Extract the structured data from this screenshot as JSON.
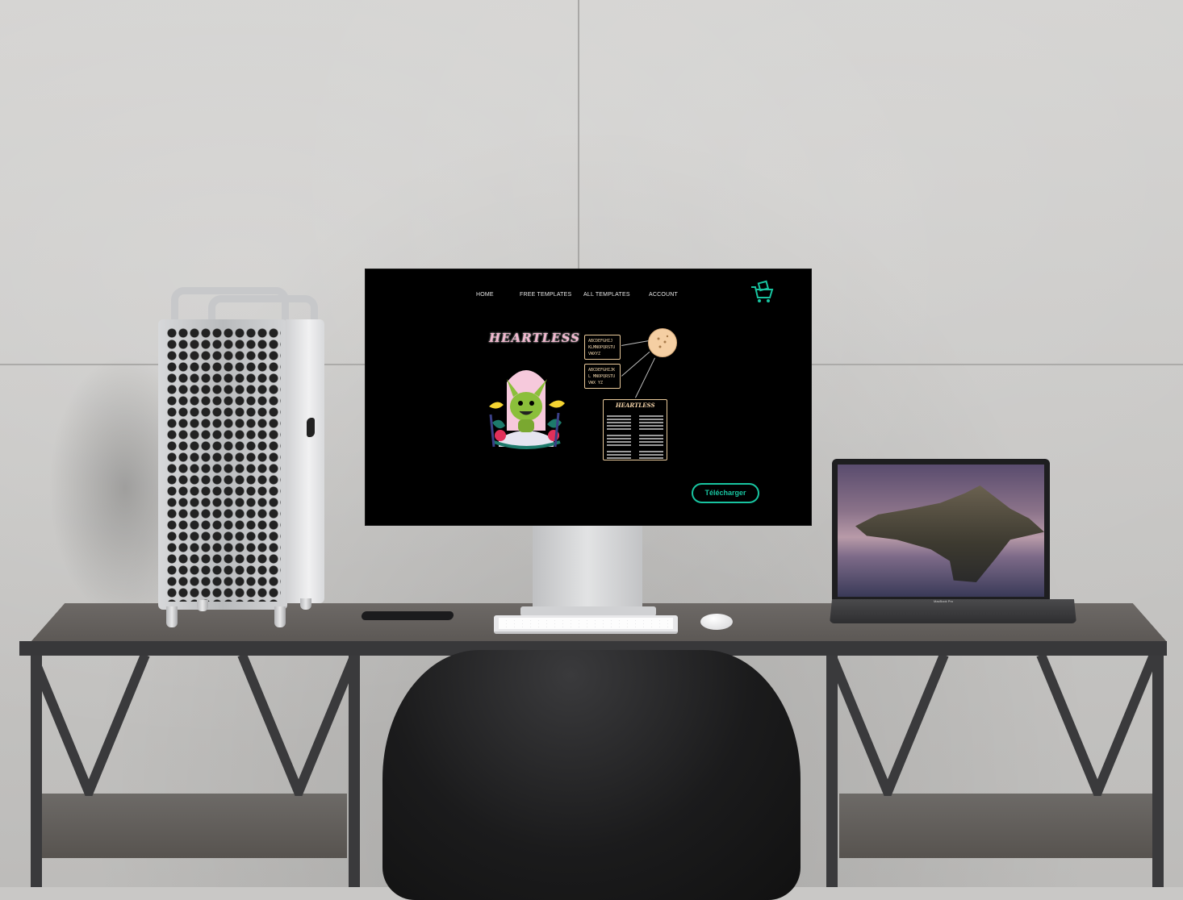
{
  "website": {
    "nav": [
      {
        "label": "HOME"
      },
      {
        "label": "FREE TEMPLATES"
      },
      {
        "label": "ALL  TEMPLATES"
      },
      {
        "label": "ACCOUNT"
      }
    ],
    "cart_icon": "shopping-cart-icon",
    "brand_title": "HEARTLESS",
    "specimens": [
      {
        "text": "ABCDEFGHIJ KLMNOPQRSTU VWXYZ"
      },
      {
        "text": "ABCDEFGHIJKL MNOPQRSTUVWX YZ"
      }
    ],
    "card_title": "HEARTLESS",
    "download_label": "Télécharger",
    "accent_color": "#18c4a0",
    "brand_color": "#f2b8cf",
    "specimen_border_color": "#e9c99a"
  },
  "laptop": {
    "model_label": "MacBook Pro"
  }
}
